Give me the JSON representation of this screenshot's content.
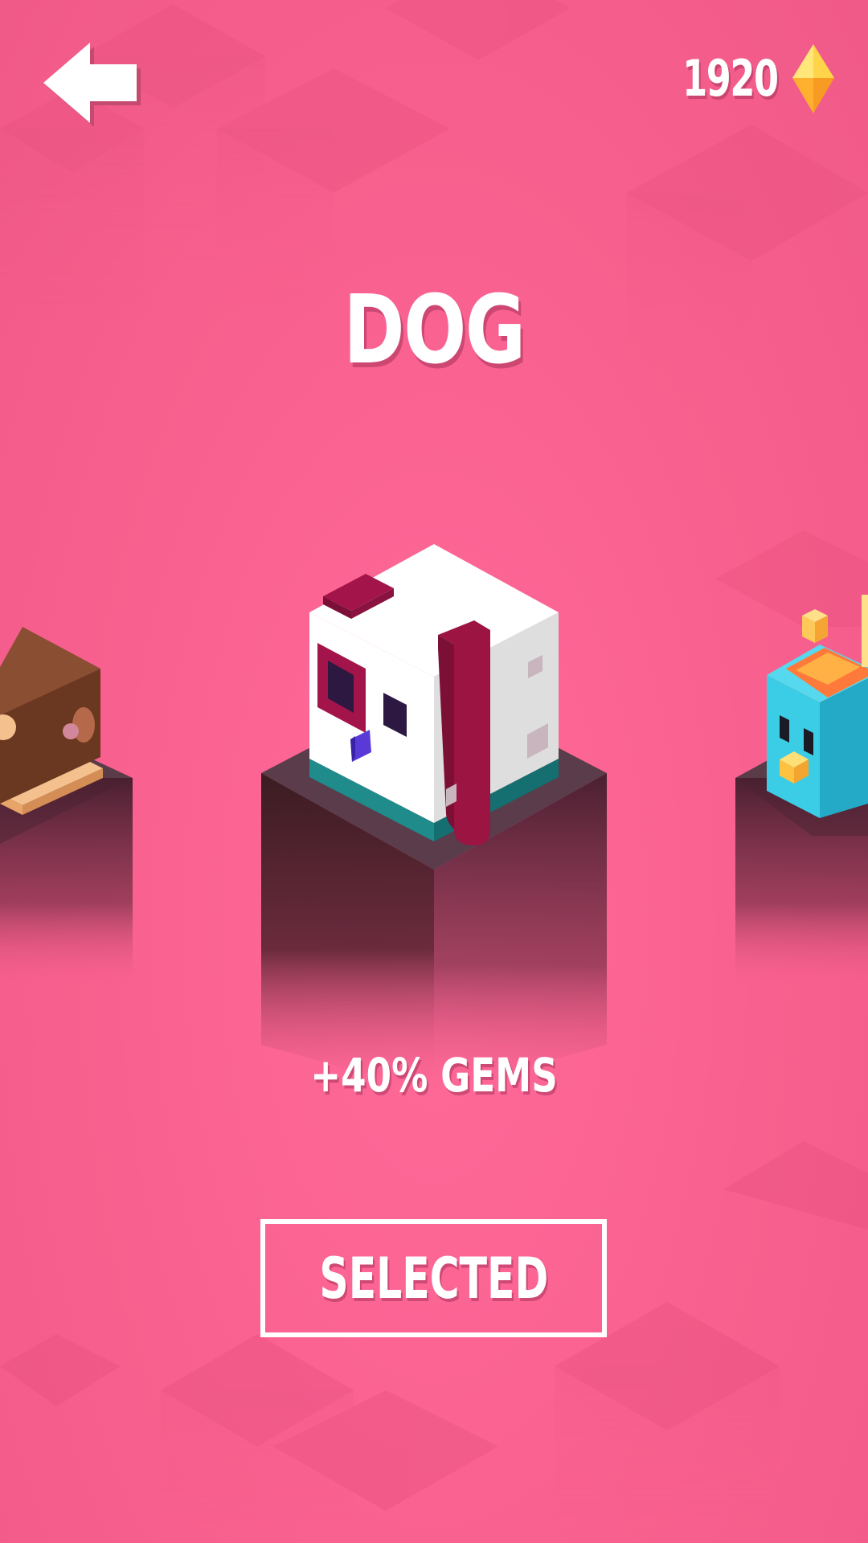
{
  "header": {
    "back_icon": "back-arrow-icon",
    "gem_count": "1920",
    "gem_icon": "gem-icon"
  },
  "character": {
    "name": "DOG",
    "bonus": "+40% GEMS",
    "select_label": "SELECTED"
  },
  "characters": [
    {
      "id": "previous",
      "icon": "brown-cube-character-icon",
      "position": "left"
    },
    {
      "id": "current",
      "icon": "dog-character-icon",
      "position": "center"
    },
    {
      "id": "next",
      "icon": "blue-bird-character-icon",
      "position": "right"
    }
  ],
  "colors": {
    "background": "#f75f8e",
    "text": "#ffffff",
    "gem": "#ffc93a"
  }
}
